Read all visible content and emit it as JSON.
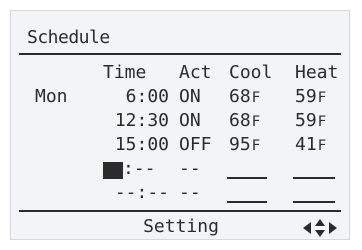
{
  "screen": {
    "title": "Schedule",
    "headers": {
      "time": "Time",
      "act": "Act",
      "cool": "Cool",
      "heat": "Heat"
    },
    "day": "Mon",
    "rows": [
      {
        "time": "6:00",
        "act": "ON",
        "cool": "68",
        "cool_unit": "F",
        "heat": "59",
        "heat_unit": "F"
      },
      {
        "time": "12:30",
        "act": "ON",
        "cool": "68",
        "cool_unit": "F",
        "heat": "59",
        "heat_unit": "F"
      },
      {
        "time": "15:00",
        "act": "OFF",
        "cool": "95",
        "cool_unit": "F",
        "heat": "41",
        "heat_unit": "F"
      },
      {
        "time_rest": ":--",
        "act": "--"
      },
      {
        "time": "--:--",
        "act": "--"
      }
    ],
    "footer": {
      "label": "Setting",
      "nav_icon": "left-up-down-right-arrows-icon"
    }
  },
  "colors": {
    "background": "#f3f4f5",
    "ink": "#2b2b2b"
  }
}
